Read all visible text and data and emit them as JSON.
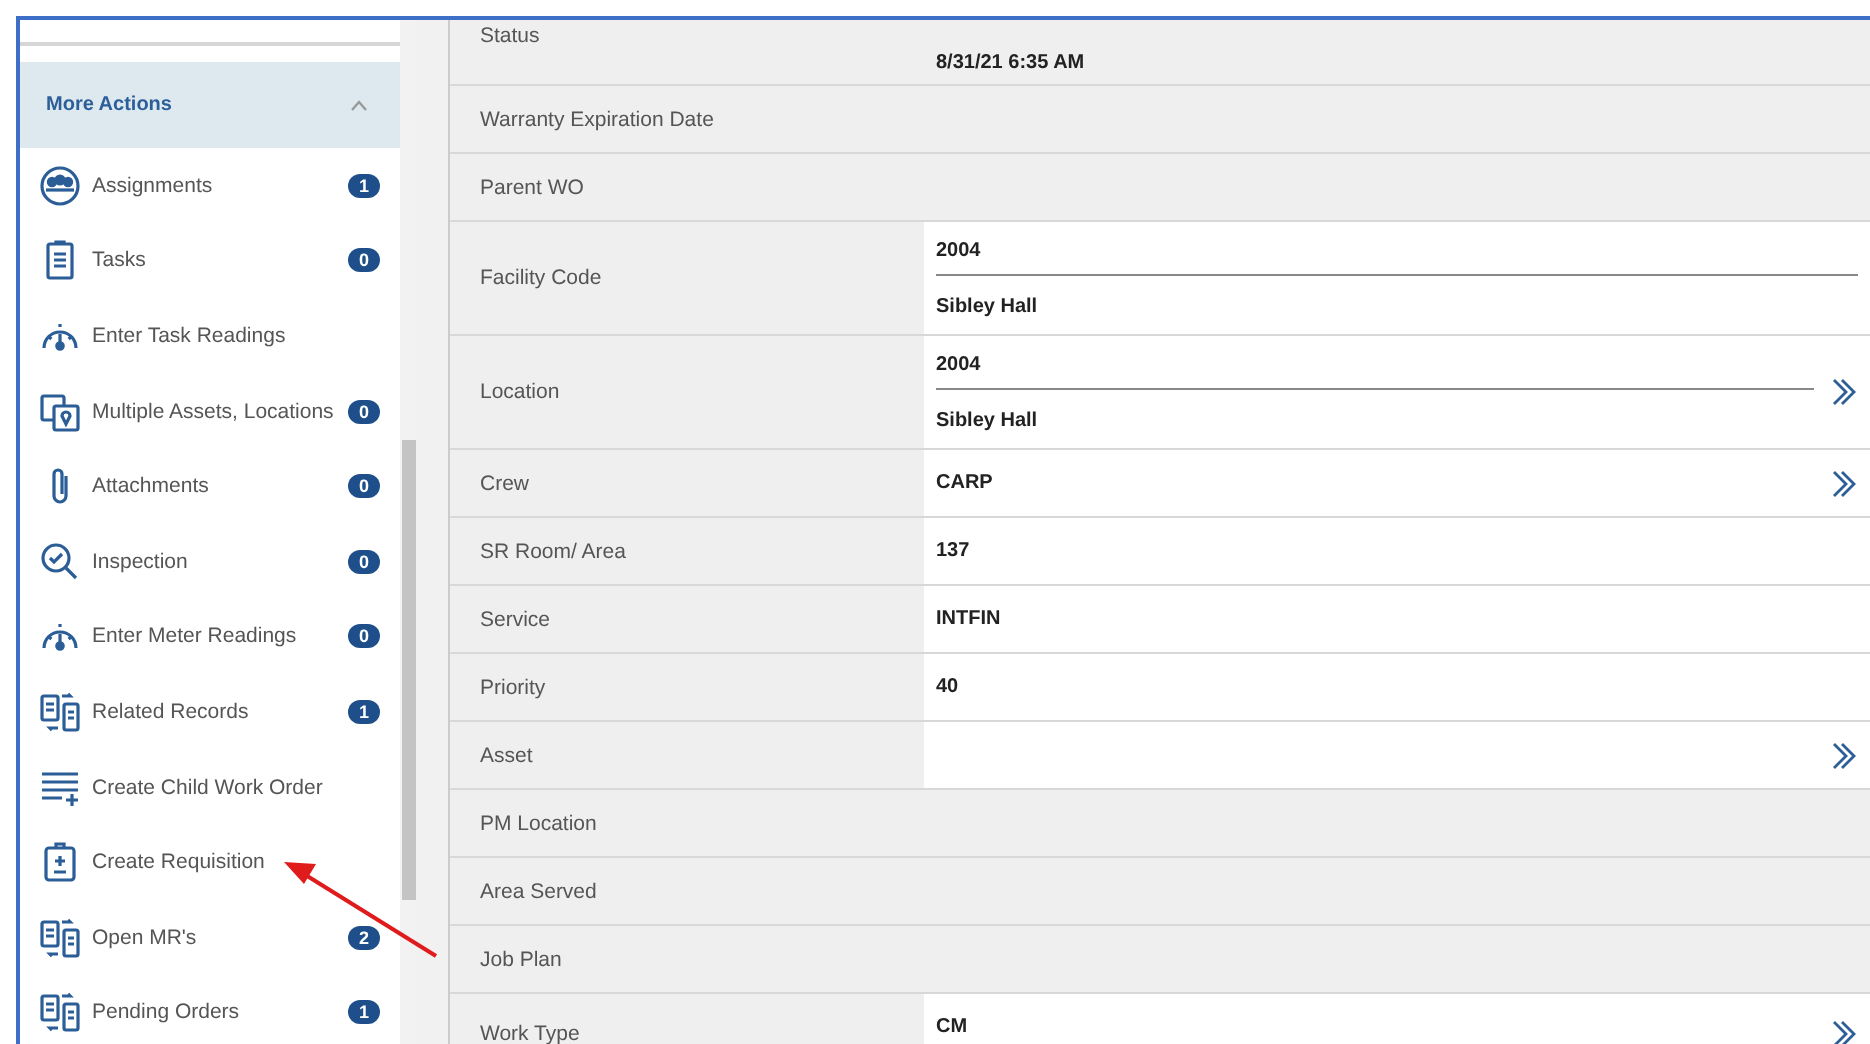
{
  "sidebar": {
    "section": {
      "title": "More Actions",
      "expanded": true
    },
    "items": [
      {
        "label": "Assignments",
        "count": "1"
      },
      {
        "label": "Tasks",
        "count": "0"
      },
      {
        "label": "Enter Task Readings"
      },
      {
        "label": "Multiple Assets, Locations",
        "count": "0"
      },
      {
        "label": "Attachments",
        "count": "0"
      },
      {
        "label": "Inspection",
        "count": "0"
      },
      {
        "label": "Enter Meter Readings",
        "count": "0"
      },
      {
        "label": "Related Records",
        "count": "1"
      },
      {
        "label": "Create Child Work Order"
      },
      {
        "label": "Create Requisition"
      },
      {
        "label": "Open MR's",
        "count": "2"
      },
      {
        "label": "Pending Orders",
        "count": "1"
      }
    ]
  },
  "details": {
    "rows": [
      {
        "label": "Status",
        "kind": "stacked",
        "value": "8/31/21 6:35 AM",
        "lookup": false
      },
      {
        "label": "Warranty Expiration Date",
        "kind": "readonly",
        "lookup": false
      },
      {
        "label": "Parent WO",
        "kind": "readonly",
        "lookup": false
      },
      {
        "label": "Facility Code",
        "kind": "code",
        "value": "2004",
        "description": "Sibley Hall",
        "lookup": false
      },
      {
        "label": "Location",
        "kind": "code",
        "value": "2004",
        "description": "Sibley Hall",
        "lookup": true
      },
      {
        "label": "Crew",
        "kind": "text",
        "value": "CARP",
        "lookup": true
      },
      {
        "label": "SR Room/ Area",
        "kind": "text",
        "value": "137",
        "lookup": false
      },
      {
        "label": "Service",
        "kind": "text",
        "value": "INTFIN",
        "lookup": false
      },
      {
        "label": "Priority",
        "kind": "text",
        "value": "40",
        "lookup": false
      },
      {
        "label": "Asset",
        "kind": "text",
        "lookup": true
      },
      {
        "label": "PM Location",
        "kind": "readonly",
        "lookup": false
      },
      {
        "label": "Area Served",
        "kind": "readonly",
        "lookup": false
      },
      {
        "label": "Job Plan",
        "kind": "readonly",
        "lookup": false
      },
      {
        "label": "Work Type",
        "kind": "code",
        "value": "CM",
        "lookup": true
      }
    ]
  }
}
